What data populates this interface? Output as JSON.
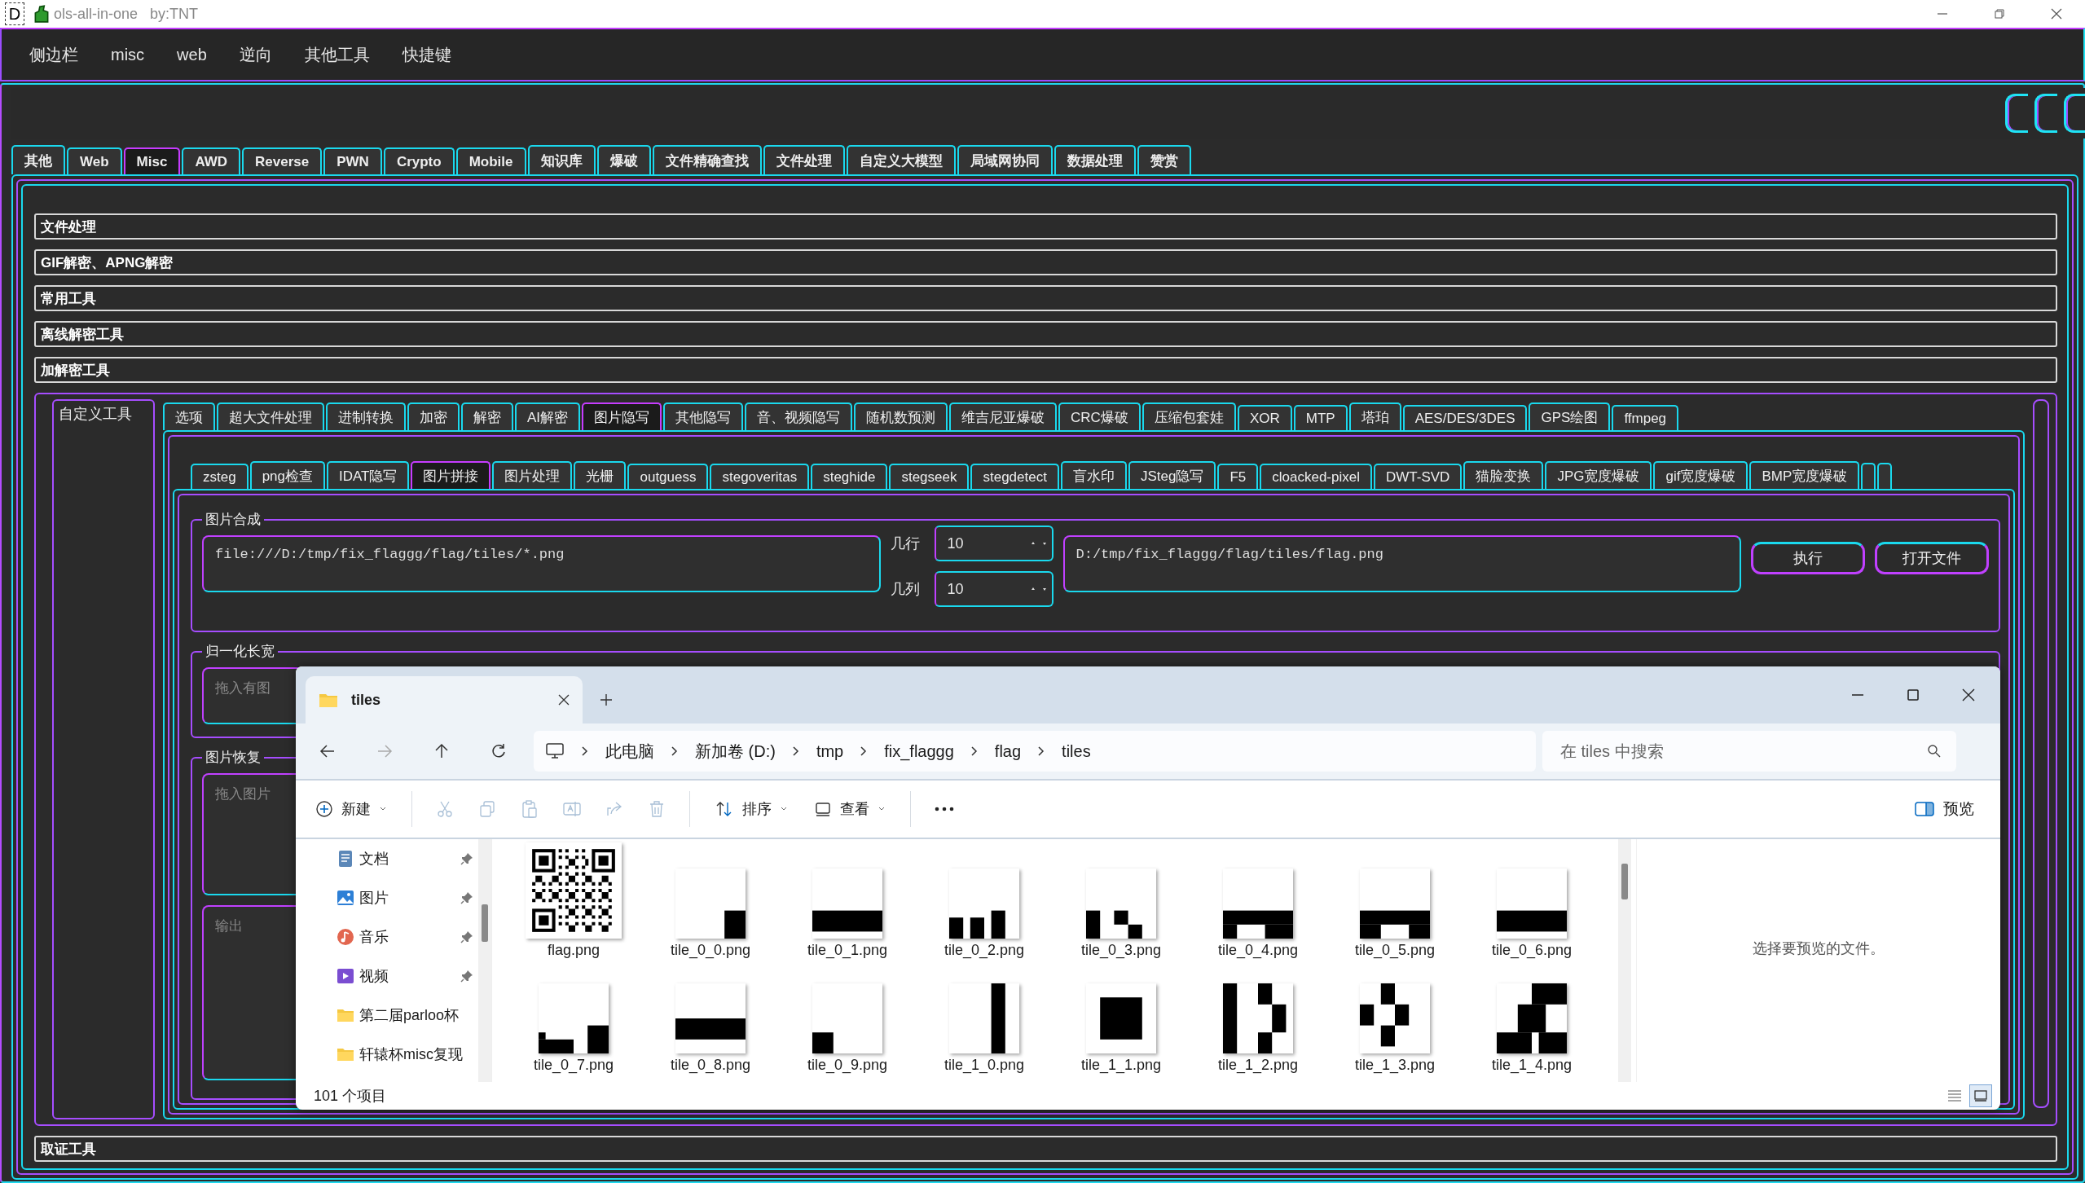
{
  "window": {
    "badge": "D",
    "title": "ols-all-in-one   by:TNT"
  },
  "menu": [
    "侧边栏",
    "misc",
    "web",
    "逆向",
    "其他工具",
    "快捷键"
  ],
  "main_tabs": [
    {
      "label": "其他",
      "selected": false
    },
    {
      "label": "Web",
      "selected": false
    },
    {
      "label": "Misc",
      "selected": true
    },
    {
      "label": "AWD",
      "selected": false
    },
    {
      "label": "Reverse",
      "selected": false
    },
    {
      "label": "PWN",
      "selected": false
    },
    {
      "label": "Crypto",
      "selected": false
    },
    {
      "label": "Mobile",
      "selected": false
    },
    {
      "label": "知识库",
      "selected": false
    },
    {
      "label": "爆破",
      "selected": false
    },
    {
      "label": "文件精确查找",
      "selected": false
    },
    {
      "label": "文件处理",
      "selected": false
    },
    {
      "label": "自定义大模型",
      "selected": false
    },
    {
      "label": "局域网协同",
      "selected": false
    },
    {
      "label": "数据处理",
      "selected": false
    },
    {
      "label": "赞赏",
      "selected": false
    }
  ],
  "sections": [
    "文件处理",
    "GIF解密、APNG解密",
    "常用工具",
    "离线解密工具",
    "加解密工具"
  ],
  "custom_tools": {
    "title": "自定义工具",
    "tabs": [
      {
        "label": "选项",
        "selected": false
      },
      {
        "label": "超大文件处理",
        "selected": false
      },
      {
        "label": "进制转换",
        "selected": false
      },
      {
        "label": "加密",
        "selected": false
      },
      {
        "label": "解密",
        "selected": false
      },
      {
        "label": "AI解密",
        "selected": false
      },
      {
        "label": "图片隐写",
        "selected": true
      },
      {
        "label": "其他隐写",
        "selected": false
      },
      {
        "label": "音、视频隐写",
        "selected": false
      },
      {
        "label": "随机数预测",
        "selected": false
      },
      {
        "label": "维吉尼亚爆破",
        "selected": false
      },
      {
        "label": "CRC爆破",
        "selected": false
      },
      {
        "label": "压缩包套娃",
        "selected": false
      },
      {
        "label": "XOR",
        "selected": false
      },
      {
        "label": "MTP",
        "selected": false
      },
      {
        "label": "塔珀",
        "selected": false
      },
      {
        "label": "AES/DES/3DES",
        "selected": false
      },
      {
        "label": "GPS绘图",
        "selected": false
      },
      {
        "label": "ffmpeg",
        "selected": false
      }
    ],
    "sub_tabs": [
      {
        "label": "zsteg",
        "selected": false
      },
      {
        "label": "png检查",
        "selected": false
      },
      {
        "label": "IDAT隐写",
        "selected": false
      },
      {
        "label": "图片拼接",
        "selected": true
      },
      {
        "label": "图片处理",
        "selected": false
      },
      {
        "label": "光栅",
        "selected": false
      },
      {
        "label": "outguess",
        "selected": false
      },
      {
        "label": "stegoveritas",
        "selected": false
      },
      {
        "label": "steghide",
        "selected": false
      },
      {
        "label": "stegseek",
        "selected": false
      },
      {
        "label": "stegdetect",
        "selected": false
      },
      {
        "label": "盲水印",
        "selected": false
      },
      {
        "label": "JSteg隐写",
        "selected": false
      },
      {
        "label": "F5",
        "selected": false
      },
      {
        "label": "cloacked-pixel",
        "selected": false
      },
      {
        "label": "DWT-SVD",
        "selected": false
      },
      {
        "label": "猫脸变换",
        "selected": false
      },
      {
        "label": "JPG宽度爆破",
        "selected": false
      },
      {
        "label": "gif宽度爆破",
        "selected": false
      },
      {
        "label": "BMP宽度爆破",
        "selected": false
      }
    ],
    "compose": {
      "title": "图片合成",
      "input": "file:///D:/tmp/fix_flaggg/flag/tiles/*.png",
      "rows_label": "几行",
      "rows": "10",
      "cols_label": "几列",
      "cols": "10",
      "output": "D:/tmp/fix_flaggg/flag/tiles/flag.png",
      "buttons": [
        "执行",
        "打开文件"
      ]
    },
    "normalize": {
      "title": "归一化长宽",
      "placeholder": "拖入有图"
    },
    "restore": {
      "title": "图片恢复",
      "placeholder": "拖入图片",
      "output_placeholder": "输出"
    }
  },
  "bottom_section": "取证工具",
  "explorer": {
    "tab": "tiles",
    "breadcrumb": [
      "此电脑",
      "新加卷 (D:)",
      "tmp",
      "fix_flaggg",
      "flag",
      "tiles"
    ],
    "search_placeholder": "在 tiles 中搜索",
    "new_label": "新建",
    "sort_label": "排序",
    "view_label": "查看",
    "preview_label": "预览",
    "nav": [
      {
        "label": "文档",
        "kind": "documents",
        "pinned": true
      },
      {
        "label": "图片",
        "kind": "pictures",
        "pinned": true
      },
      {
        "label": "音乐",
        "kind": "music",
        "pinned": true
      },
      {
        "label": "视频",
        "kind": "videos",
        "pinned": true
      },
      {
        "label": "第二届parloo杯",
        "kind": "folder",
        "pinned": false
      },
      {
        "label": "轩辕杯misc复现",
        "kind": "folder",
        "pinned": false
      }
    ],
    "files": [
      {
        "name": "flag.png",
        "kind": "qr"
      },
      {
        "name": "tile_0_0.png",
        "kind": "tile"
      },
      {
        "name": "tile_0_1.png",
        "kind": "tile"
      },
      {
        "name": "tile_0_2.png",
        "kind": "tile"
      },
      {
        "name": "tile_0_3.png",
        "kind": "tile"
      },
      {
        "name": "tile_0_4.png",
        "kind": "tile"
      },
      {
        "name": "tile_0_5.png",
        "kind": "tile"
      },
      {
        "name": "tile_0_6.png",
        "kind": "tile"
      },
      {
        "name": "tile_0_7.png",
        "kind": "tile"
      },
      {
        "name": "tile_0_8.png",
        "kind": "tile"
      },
      {
        "name": "tile_0_9.png",
        "kind": "tile"
      },
      {
        "name": "tile_1_0.png",
        "kind": "tile"
      },
      {
        "name": "tile_1_1.png",
        "kind": "tile"
      },
      {
        "name": "tile_1_2.png",
        "kind": "tile"
      },
      {
        "name": "tile_1_3.png",
        "kind": "tile"
      },
      {
        "name": "tile_1_4.png",
        "kind": "tile"
      }
    ],
    "preview_text": "选择要预览的文件。",
    "status": "101 个项目",
    "view_modes": [
      {
        "kind": "details",
        "selected": false
      },
      {
        "kind": "thumbnails",
        "selected": true
      }
    ]
  }
}
